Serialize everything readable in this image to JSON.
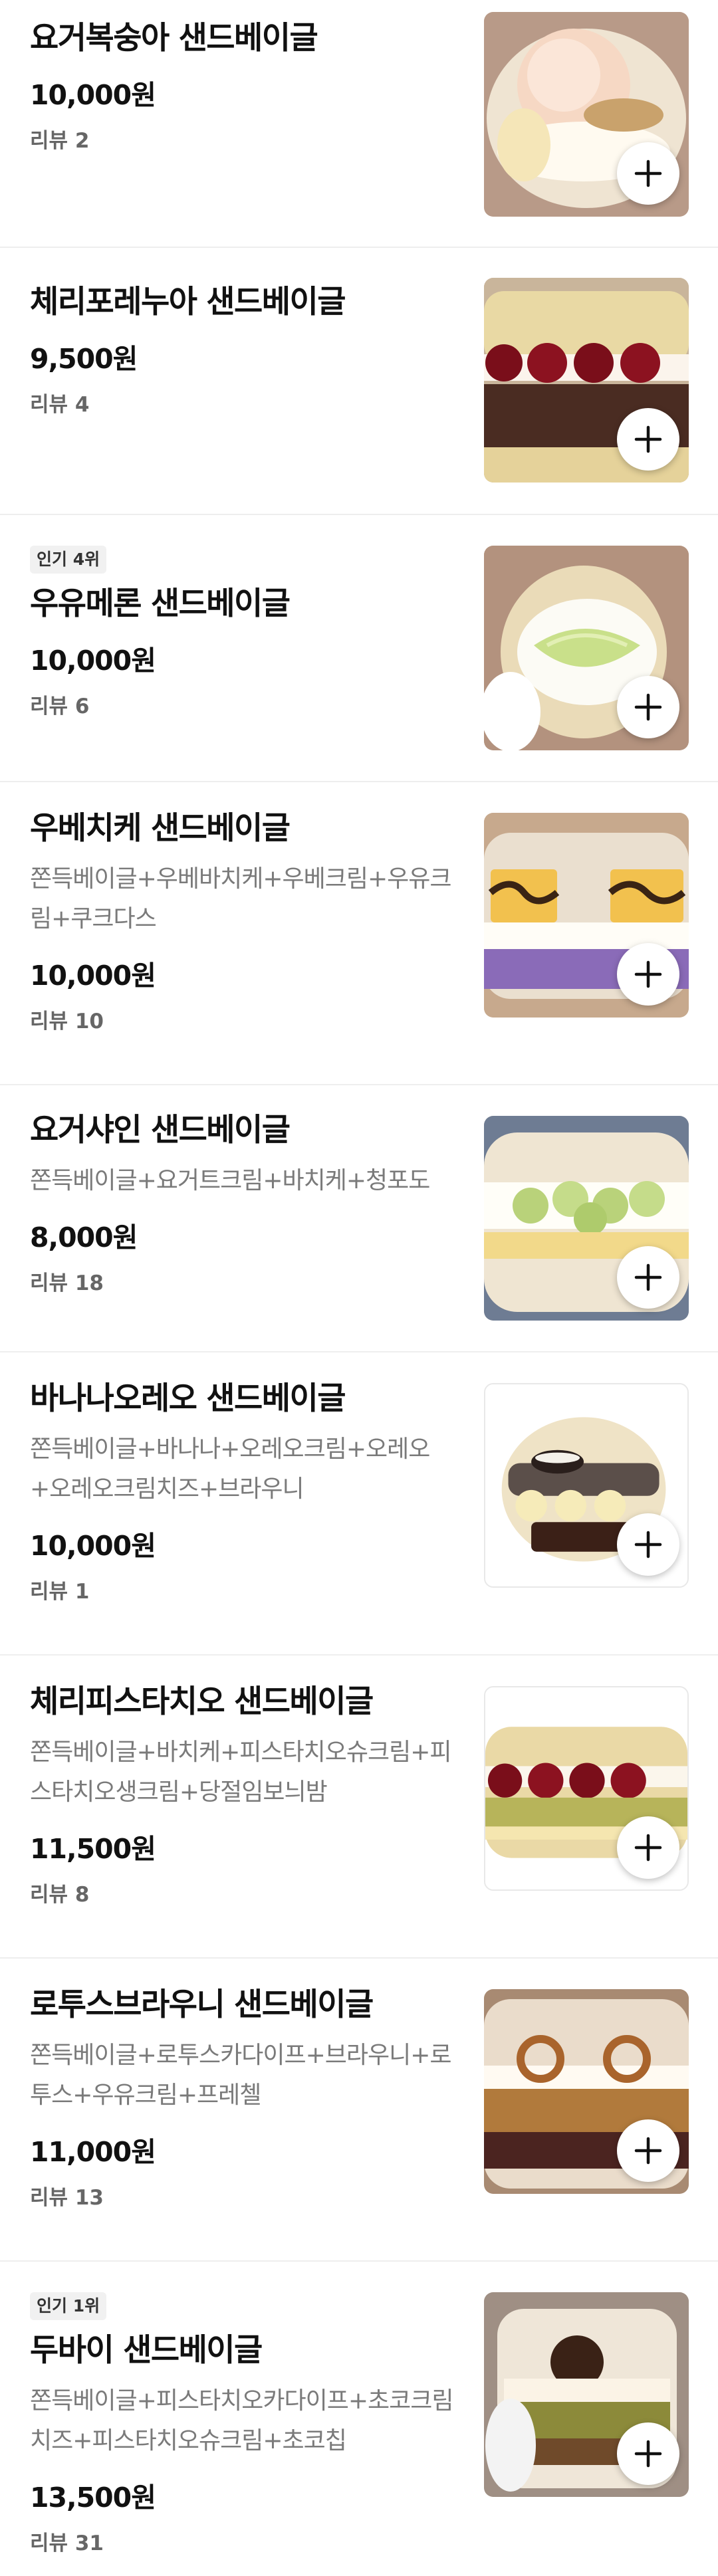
{
  "menu": {
    "items": [
      {
        "badge": "",
        "name": "요거복숭아 샌드베이글",
        "desc": "",
        "price": "10,000원",
        "reviews": "리뷰 2",
        "image": "peach-yogurt-bagel"
      },
      {
        "badge": "",
        "name": "체리포레누아 샌드베이글",
        "desc": "",
        "price": "9,500원",
        "reviews": "리뷰 4",
        "image": "cherry-chocolate-bagel"
      },
      {
        "badge": "인기 4위",
        "name": "우유메론 샌드베이글",
        "desc": "",
        "price": "10,000원",
        "reviews": "리뷰 6",
        "image": "melon-cream-bagel"
      },
      {
        "badge": "",
        "name": "우베치케 샌드베이글",
        "desc": "쫀득베이글+우베바치케+우베크림+우유크림+쿠크다스",
        "price": "10,000원",
        "reviews": "리뷰 10",
        "image": "ube-cake-bagel"
      },
      {
        "badge": "",
        "name": "요거샤인 샌드베이글",
        "desc": "쫀득베이글+요거트크림+바치케+청포도",
        "price": "8,000원",
        "reviews": "리뷰 18",
        "image": "shine-muscat-bagel"
      },
      {
        "badge": "",
        "name": "바나나오레오 샌드베이글",
        "desc": "쫀득베이글+바나나+오레오크림+오레오+오레오크림치즈+브라우니",
        "price": "10,000원",
        "reviews": "리뷰 1",
        "image": "banana-oreo-bagel"
      },
      {
        "badge": "",
        "name": "체리피스타치오 샌드베이글",
        "desc": "쫀득베이글+바치케+피스타치오슈크림+피스타치오생크림+당절임보늬밤",
        "price": "11,500원",
        "reviews": "리뷰 8",
        "image": "cherry-pistachio-bagel"
      },
      {
        "badge": "",
        "name": "로투스브라우니 샌드베이글",
        "desc": "쫀득베이글+로투스카다이프+브라우니+로투스+우유크림+프레첼",
        "price": "11,000원",
        "reviews": "리뷰 13",
        "image": "lotus-brownie-bagel"
      },
      {
        "badge": "인기 1위",
        "name": "두바이 샌드베이글",
        "desc": "쫀득베이글+피스타치오카다이프+초코크림치즈+피스타치오슈크림+초코칩",
        "price": "13,500원",
        "reviews": "리뷰 31",
        "image": "dubai-chocolate-bagel"
      }
    ]
  },
  "icons": {
    "add": "plus-icon"
  },
  "colors": {
    "text_primary": "#111111",
    "text_secondary": "#7a7a7a",
    "badge_bg": "#f1f1f1",
    "divider": "#eeeeee"
  }
}
